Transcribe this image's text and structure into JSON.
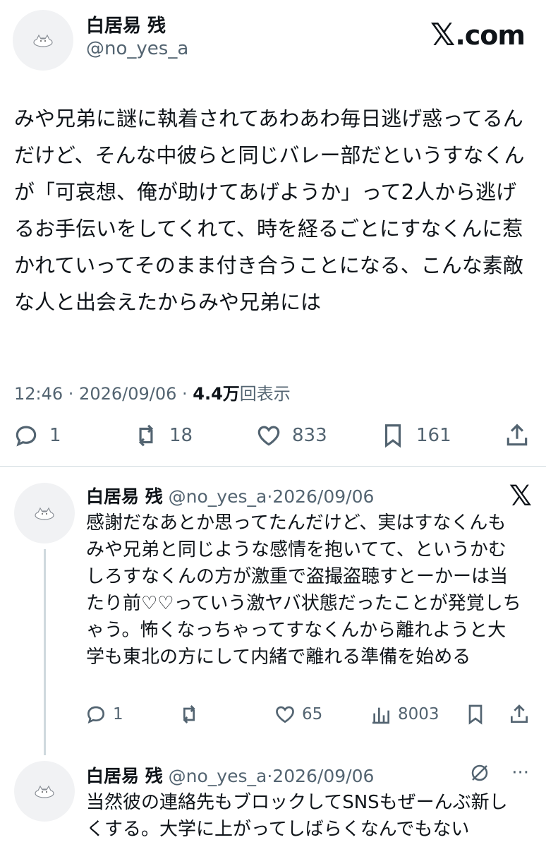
{
  "main": {
    "author_name": "白居易 残",
    "handle": "@no_yes_a",
    "brand": ".com",
    "brand_x": "𝕏",
    "text": "みや兄弟に謎に執着されてあわあわ毎日逃げ惑ってるんだけど、そんな中彼らと同じバレー部だというすなくんが「可哀想、俺が助けてあげようか」って2人から逃げるお手伝いをしてくれて、時を経るごとにすなくんに惹かれていってそのまま付き合うことになる、こんな素敵な人と出会えたからみや兄弟には",
    "time": "12:46 · 2026/09/06 · ",
    "views_count": "4.4万",
    "views_label": "回表示",
    "replies": "1",
    "reposts": "18",
    "likes": "833",
    "bookmarks": "161"
  },
  "reply1": {
    "author_name": "白居易 残",
    "handle": "@no_yes_a",
    "date": "·2026/09/06",
    "x_logo": "𝕏",
    "text": "感謝だなあとか思ってたんだけど、実はすなくんもみや兄弟と同じような感情を抱いてて、というかむしろすなくんの方が激重で盗撮盗聴すとーかーは当たり前♡♡っていう激ヤバ状態だったことが発覚しちゃう。怖くなっちゃってすなくんから離れようと大学も東北の方にして内緒で離れる準備を始める",
    "replies": "1",
    "likes": "65",
    "views": "8003"
  },
  "reply2": {
    "author_name": "白居易 残",
    "handle": "@no_yes_a",
    "date": "·2026/09/06",
    "more": "···",
    "text": "当然彼の連絡先もブロックしてSNSもぜーんぶ新しくする。大学に上がってしばらくなんでもない"
  }
}
